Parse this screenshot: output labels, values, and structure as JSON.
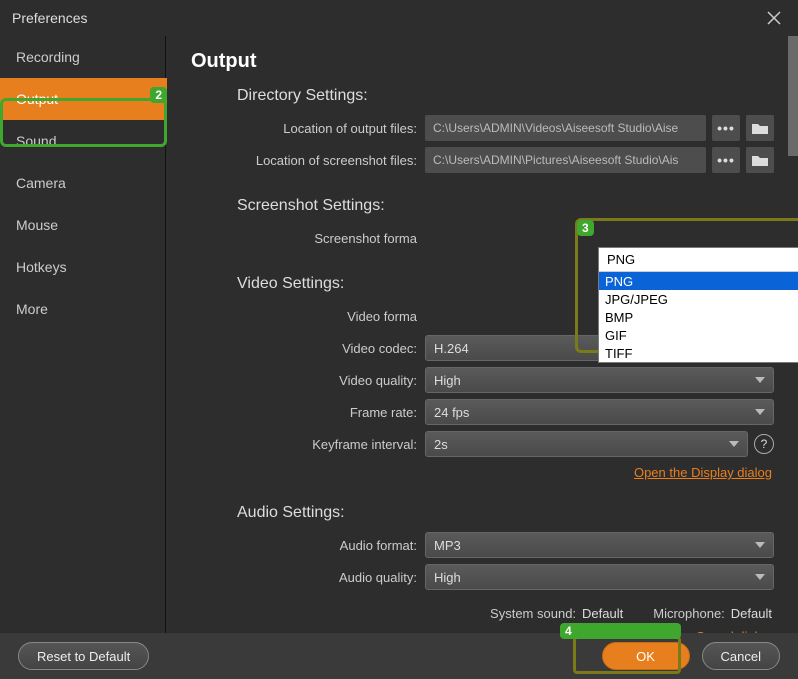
{
  "title": "Preferences",
  "page_heading": "Output",
  "sidebar": {
    "items": [
      {
        "label": "Recording"
      },
      {
        "label": "Output"
      },
      {
        "label": "Sound"
      },
      {
        "label": "Camera"
      },
      {
        "label": "Mouse"
      },
      {
        "label": "Hotkeys"
      },
      {
        "label": "More"
      }
    ]
  },
  "markers": {
    "m2": "2",
    "m3": "3",
    "m4": "4"
  },
  "sections": {
    "directory": {
      "title": "Directory Settings:",
      "output_label": "Location of output files:",
      "output_value": "C:\\Users\\ADMIN\\Videos\\Aiseesoft Studio\\Aise",
      "screenshot_label": "Location of screenshot files:",
      "screenshot_value": "C:\\Users\\ADMIN\\Pictures\\Aiseesoft Studio\\Ais"
    },
    "screenshot": {
      "title": "Screenshot Settings:",
      "format_label": "Screenshot forma",
      "format_value": "PNG",
      "options": [
        "PNG",
        "JPG/JPEG",
        "BMP",
        "GIF",
        "TIFF"
      ]
    },
    "video": {
      "title": "Video Settings:",
      "format_label": "Video forma",
      "codec_label": "Video codec:",
      "codec_value": "H.264",
      "quality_label": "Video quality:",
      "quality_value": "High",
      "frame_label": "Frame rate:",
      "frame_value": "24 fps",
      "keyframe_label": "Keyframe interval:",
      "keyframe_value": "2s",
      "link": "Open the Display dialog"
    },
    "audio": {
      "title": "Audio Settings:",
      "format_label": "Audio format:",
      "format_value": "MP3",
      "quality_label": "Audio quality:",
      "quality_value": "High",
      "system_label": "System sound:",
      "system_value": "Default",
      "mic_label": "Microphone:",
      "mic_value": "Default",
      "link": "Open the Sound dialog"
    }
  },
  "footer": {
    "reset": "Reset to Default",
    "ok": "OK",
    "cancel": "Cancel"
  },
  "help": "?"
}
